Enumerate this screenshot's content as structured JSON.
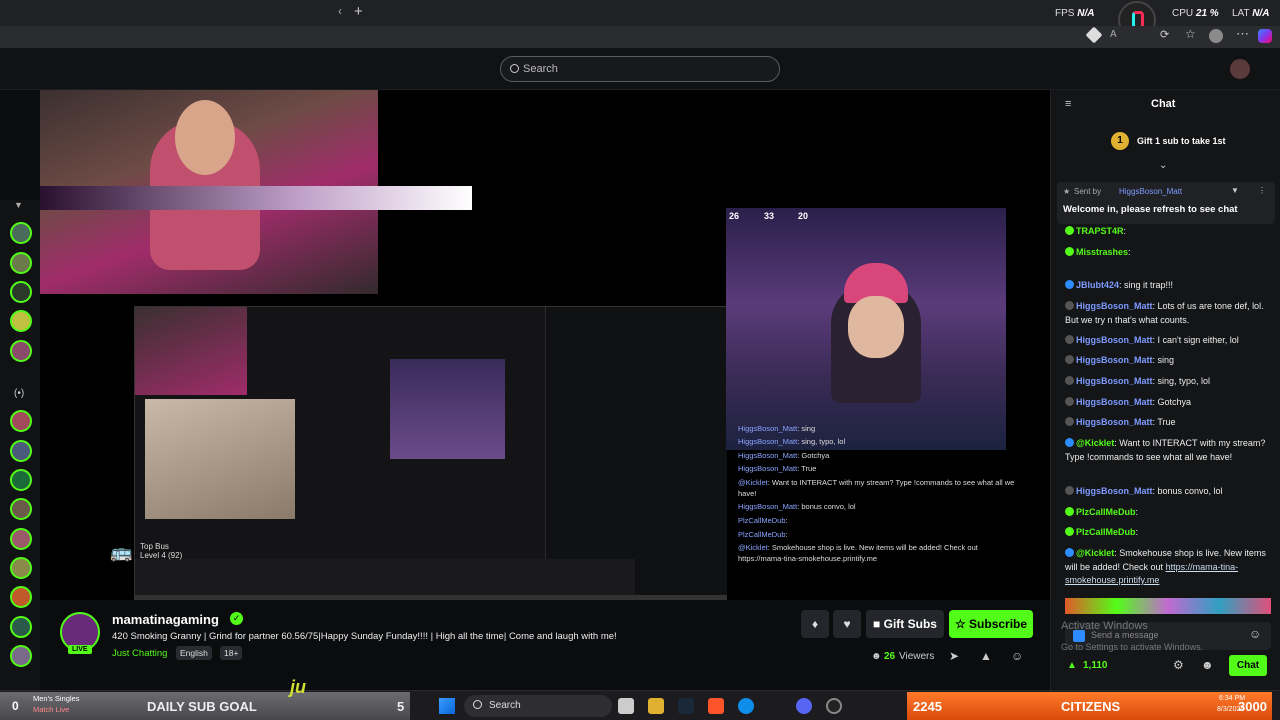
{
  "browser": {
    "fps_label": "FPS",
    "fps_value": "N/A",
    "cpu_label": "CPU",
    "cpu_value": "21 %",
    "lat_label": "LAT",
    "lat_value": "N/A",
    "new_tab": "+"
  },
  "header": {
    "search_placeholder": "Search"
  },
  "stream": {
    "viewer_stats": [
      "26",
      "33",
      "20"
    ],
    "bus_title": "Top Bus",
    "bus_level": "Level 4 (92)",
    "overlay_chat": [
      {
        "user": "HiggsBoson_Matt",
        "text": ": sing"
      },
      {
        "user": "HiggsBoson_Matt",
        "text": ": sing, typo, lol"
      },
      {
        "user": "HiggsBoson_Matt",
        "text": ": Gotchya"
      },
      {
        "user": "HiggsBoson_Matt",
        "text": ": True"
      },
      {
        "user": "@Kicklet",
        "text": ": Want to INTERACT with my stream? Type !commands to see what all we"
      },
      {
        "user": "",
        "text": "have!"
      },
      {
        "user": "HiggsBoson_Matt",
        "text": ": bonus convo, lol"
      },
      {
        "user": "PlzCallMeDub",
        "text": ":"
      },
      {
        "user": "PlzCallMeDub",
        "text": ":"
      },
      {
        "user": "@Kicklet",
        "text": ": Smokehouse shop is live. New items will be added! Check out"
      },
      {
        "user": "",
        "text": "https://mama-tina-smokehouse.printify.me"
      }
    ]
  },
  "channel": {
    "name": "mamatinagaming",
    "title": "420 Smoking Granny | Grind for partner 60.56/75|Happy Sunday Funday!!!! | High all the time| Come and laugh with me!",
    "category": "Just Chatting",
    "tags": [
      "English",
      "18+"
    ],
    "live_label": "LIVE",
    "gift_subs": "Gift Subs",
    "subscribe": "Subscribe",
    "viewers_count": "26",
    "viewers_label": "Viewers"
  },
  "chat": {
    "title": "Chat",
    "gift_prompt": "Gift 1 sub to take 1st",
    "gift_rank": "1",
    "pinned_sent_by": "Sent by",
    "pinned_user": "HiggsBoson_Matt",
    "pinned_text": "Welcome in, please refresh to see chat",
    "messages": [
      {
        "user": "TRAPST4R",
        "text": ":"
      },
      {
        "user": "Misstrashes",
        "text": ":"
      },
      {
        "user": "JBlubt424",
        "text": ": sing it trap!!!"
      },
      {
        "user": "HiggsBoson_Matt",
        "text": ": Lots of us are tone def, lol. But we try n that's what counts."
      },
      {
        "user": "HiggsBoson_Matt",
        "text": ": I can't sign either, lol"
      },
      {
        "user": "HiggsBoson_Matt",
        "text": ": sing"
      },
      {
        "user": "HiggsBoson_Matt",
        "text": ": sing, typo, lol"
      },
      {
        "user": "HiggsBoson_Matt",
        "text": ": Gotchya"
      },
      {
        "user": "HiggsBoson_Matt",
        "text": ": True"
      },
      {
        "user": "@Kicklet",
        "text": ": Want to INTERACT with my stream? Type !commands to see what all we have!"
      },
      {
        "user": "HiggsBoson_Matt",
        "text": ": bonus convo, lol"
      },
      {
        "user": "PlzCallMeDub",
        "text": ":"
      },
      {
        "user": "PlzCallMeDub",
        "text": ":"
      },
      {
        "user": "@Kicklet",
        "text": ": Smokehouse shop is live. New items will be added! Check out "
      },
      {
        "user": "",
        "text": "https://mama-tina-smokehouse.printify.me"
      }
    ],
    "input_placeholder": "Send a message",
    "points": "1,110",
    "chat_button": "Chat",
    "watermark_1": "Activate Windows",
    "watermark_2": "Go to Settings to activate Windows."
  },
  "overlay": {
    "mens_singles": "Men's Singles",
    "match_live": "Match Live",
    "left_count": "0",
    "daily_sub_goal": "DAILY SUB GOAL",
    "sub_goal_value": "5",
    "count_2245": "2245",
    "citizens": "CITIZENS",
    "count_3000": "3000"
  },
  "taskbar": {
    "search": "Search",
    "time": "6:34 PM",
    "date": "8/3/2025"
  },
  "colors": {
    "accent": "#53fc18",
    "username": "#7e9bff"
  }
}
